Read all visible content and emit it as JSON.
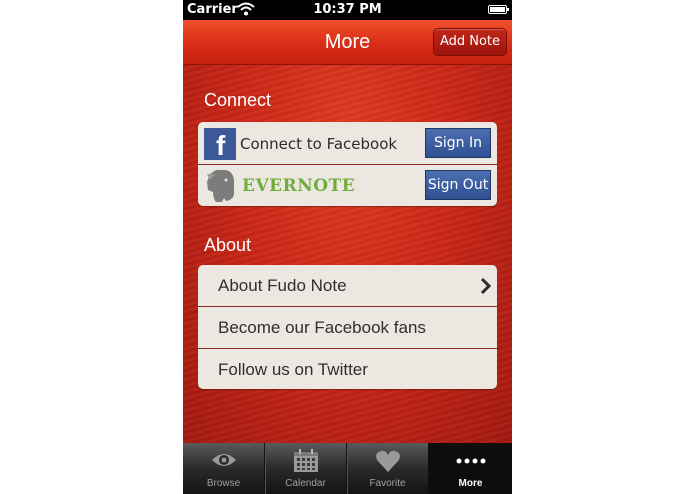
{
  "status_bar": {
    "carrier": "Carrier",
    "time": "10:37 PM"
  },
  "navbar": {
    "title": "More",
    "add_note_label": "Add Note"
  },
  "connect": {
    "heading": "Connect",
    "facebook": {
      "label": "Connect to Facebook",
      "button": "Sign In"
    },
    "evernote": {
      "label": "EVERNOTE",
      "button": "Sign Out"
    }
  },
  "about": {
    "heading": "About",
    "items": [
      {
        "label": "About Fudo Note"
      },
      {
        "label": "Become our Facebook fans"
      },
      {
        "label": "Follow us on Twitter"
      }
    ]
  },
  "tabbar": {
    "tabs": [
      {
        "label": "Browse",
        "icon": "eye-icon"
      },
      {
        "label": "Calendar",
        "icon": "calendar-icon"
      },
      {
        "label": "Favorite",
        "icon": "heart-icon"
      },
      {
        "label": "More",
        "icon": "more-dots-icon",
        "active": true
      }
    ]
  },
  "colors": {
    "nav_red": "#d92d16",
    "background_red": "#cc2717",
    "facebook_blue": "#3b5998",
    "evernote_green": "#6fae3a",
    "button_blue": "#2f4f91"
  }
}
